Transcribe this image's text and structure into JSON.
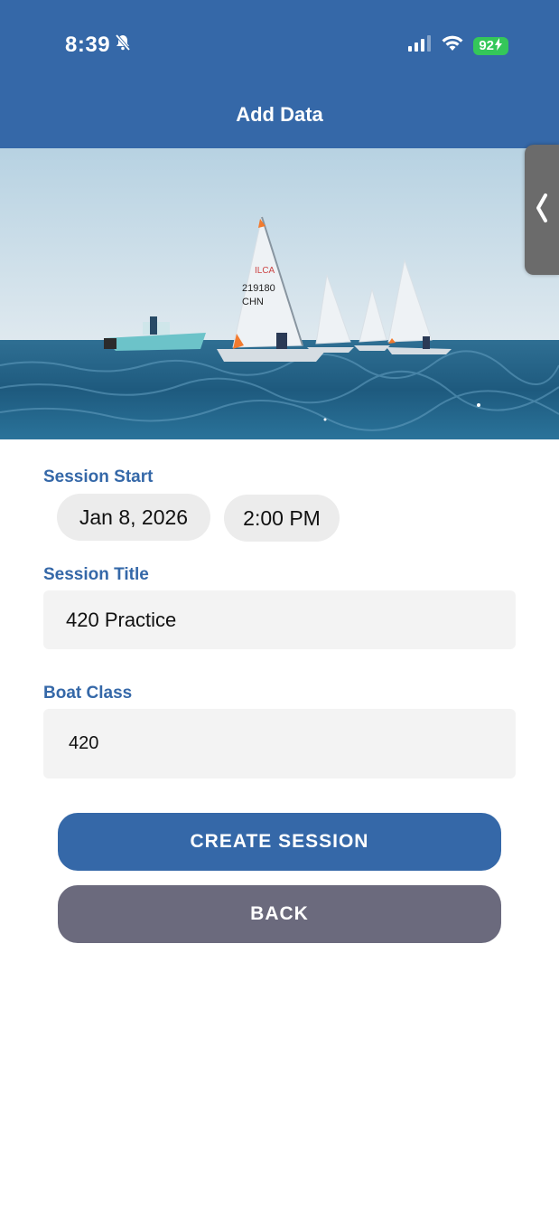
{
  "status_bar": {
    "time": "8:39",
    "battery": "92"
  },
  "header": {
    "title": "Add Data"
  },
  "hero": {
    "sail_numbers": [
      "ILCA",
      "219180",
      "CHN"
    ]
  },
  "form": {
    "session_start_label": "Session Start",
    "date": "Jan 8, 2026",
    "time": "2:00 PM",
    "session_title_label": "Session Title",
    "session_title_value": "420 Practice",
    "boat_class_label": "Boat Class",
    "boat_class_value": "420"
  },
  "buttons": {
    "create": "CREATE SESSION",
    "back": "BACK"
  },
  "colors": {
    "primary": "#3568a8",
    "secondary": "#6b6a7d",
    "battery": "#34c759"
  }
}
